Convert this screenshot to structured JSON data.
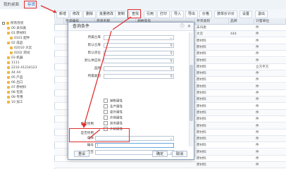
{
  "tabs": [
    {
      "label": "我的桌面"
    },
    {
      "label": "存货"
    }
  ],
  "toolbar": {
    "buttons": [
      "新增",
      "修改",
      "删除",
      "批量修改",
      "复制",
      "查找",
      "引用",
      "打印",
      "导入",
      "导出",
      "价格",
      "按单价计价",
      "设置",
      "退出"
    ]
  },
  "sidebar": {
    "items": [
      {
        "label": "所有存货"
      },
      {
        "label": "00 未归类"
      },
      {
        "label": "01 原材料"
      },
      {
        "label": "0101 配件"
      },
      {
        "label": "02 成品"
      },
      {
        "label": "02010 大云"
      },
      {
        "label": "0202 测试"
      },
      {
        "label": "03 机器"
      },
      {
        "label": "1111"
      },
      {
        "label": "2233 41234123"
      },
      {
        "label": "44 44"
      },
      {
        "label": "05 产品"
      },
      {
        "label": "06 出口"
      },
      {
        "label": "07 原材料"
      },
      {
        "label": "08 包装"
      },
      {
        "label": "09 专用"
      },
      {
        "label": "10 加工"
      }
    ]
  },
  "grid": {
    "headers": [
      "存货编号",
      "存货名称",
      "规格型号",
      "存货类别",
      "品牌",
      "计量单位"
    ],
    "rows": [
      [
        "",
        "",
        "",
        "未归类",
        "",
        "件"
      ],
      [
        "",
        "",
        "",
        "大云",
        "444",
        "件"
      ],
      [
        "",
        "",
        "",
        "原材料",
        "",
        "件"
      ],
      [
        "",
        "",
        "",
        "原材料",
        "",
        "件"
      ],
      [
        "",
        "",
        "",
        "原材料",
        "",
        "件"
      ],
      [
        "",
        "",
        "",
        "原材料",
        "",
        "件"
      ],
      [
        "",
        "",
        "",
        "原材料",
        "",
        "立方平方"
      ],
      [
        "",
        "",
        "",
        "原材料",
        "",
        "件"
      ],
      [
        "",
        "",
        "",
        "原材料",
        "",
        "件"
      ],
      [
        "",
        "",
        "",
        "原材料",
        "",
        "件"
      ],
      [
        "",
        "",
        "",
        "原材料",
        "",
        "件"
      ],
      [
        "",
        "",
        "",
        "原材料",
        "",
        "件"
      ],
      [
        "",
        "",
        "",
        "原材料",
        "",
        "件"
      ],
      [
        "",
        "",
        "",
        "原材料",
        "",
        "件"
      ],
      [
        "",
        "",
        "",
        "原材料",
        "",
        "件"
      ],
      [
        "",
        "",
        "",
        "原材料",
        "",
        "件"
      ],
      [
        "",
        "",
        "",
        "原材料",
        "",
        "件"
      ],
      [
        "",
        "",
        "",
        "原材料",
        "",
        "件"
      ],
      [
        "",
        "",
        "",
        "原材料",
        "",
        "件"
      ],
      [
        "",
        "",
        "",
        "原材料",
        "",
        "件"
      ],
      [
        "",
        "",
        "",
        "原材料",
        "",
        "件"
      ],
      [
        "",
        "",
        "",
        "原材料",
        "",
        "件"
      ]
    ]
  },
  "dialog": {
    "title": "查询条件",
    "fields": [
      {
        "label": "所属仓库",
        "value": ""
      },
      {
        "label": "默认仓库",
        "value": ""
      },
      {
        "label": "默认货位",
        "value": ""
      },
      {
        "label": "默认供应商",
        "value": ""
      },
      {
        "label": "品牌",
        "value": ""
      },
      {
        "label": "所属类别",
        "value": ""
      }
    ],
    "checkboxes": [
      {
        "label": "销售属性"
      },
      {
        "label": "生产属性"
      },
      {
        "label": "委外属性"
      },
      {
        "label": "外购属性"
      },
      {
        "label": "劳务属性"
      },
      {
        "label": "外销属性"
      }
    ],
    "extra_fields": [
      {
        "label": "是否停用",
        "value": ""
      },
      {
        "label": "选择",
        "value": ""
      },
      {
        "label": "编号",
        "value": "|"
      },
      {
        "label": "是否",
        "value": ""
      }
    ],
    "buttons": {
      "reset": "重设",
      "ok": "确定",
      "cancel": "取消"
    }
  },
  "colors": {
    "accent": "#1a5fb4",
    "annotation": "#e03030"
  }
}
